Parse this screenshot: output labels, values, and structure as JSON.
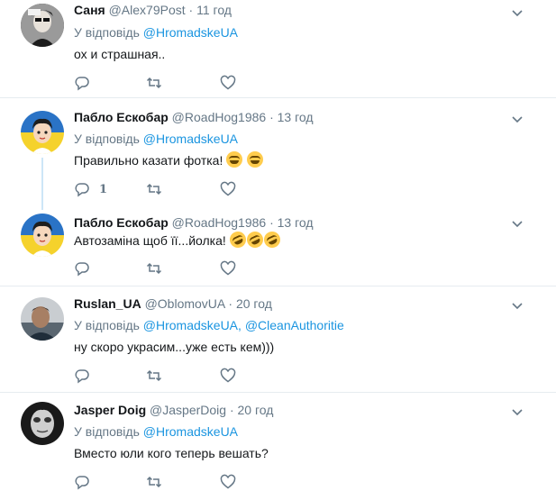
{
  "tweets": [
    {
      "name": "Саня",
      "handle": "@Alex79Post",
      "dot": "·",
      "time": "11 год",
      "reply_prefix": "У відповідь",
      "mentions": [
        "@HromadskeUA"
      ],
      "text": "ох и страшная..",
      "emojis": [],
      "reply_count": "",
      "avatar": "dark-portrait"
    },
    {
      "name": "Пабло Ескобар",
      "handle": "@RoadHog1986",
      "dot": "·",
      "time": "13 год",
      "reply_prefix": "У відповідь",
      "mentions": [
        "@HromadskeUA"
      ],
      "text": "Правильно казати фотка!",
      "emojis": [
        "face-with-tears-of-joy",
        "face-with-tears-of-joy"
      ],
      "reply_count": "1",
      "avatar": "cartoon-ua-flag"
    },
    {
      "name": "Пабло Ескобар",
      "handle": "@RoadHog1986",
      "dot": "·",
      "time": "13 год",
      "reply_prefix": "",
      "mentions": [],
      "text": "Автозаміна щоб її...йолка!",
      "emojis": [
        "rolling-on-the-floor-laughing",
        "rolling-on-the-floor-laughing",
        "rolling-on-the-floor-laughing"
      ],
      "reply_count": "",
      "avatar": "cartoon-ua-flag"
    },
    {
      "name": "Ruslan_UA",
      "handle": "@OblomovUA",
      "dot": "·",
      "time": "20 год",
      "reply_prefix": "У відповідь",
      "mentions": [
        "@HromadskeUA,",
        "@CleanAuthoritie"
      ],
      "text": "ну скоро украсим...уже есть кем)))",
      "emojis": [],
      "reply_count": "",
      "avatar": "man-photo"
    },
    {
      "name": "Jasper Doig",
      "handle": "@JasperDoig",
      "dot": "·",
      "time": "20 год",
      "reply_prefix": "У відповідь",
      "mentions": [
        "@HromadskeUA"
      ],
      "text": "Вместо юли кого теперь вешать?",
      "emojis": [],
      "reply_count": "",
      "avatar": "bw-face"
    }
  ],
  "icons": {
    "reply": "reply-icon",
    "retweet": "retweet-icon",
    "like": "heart-icon",
    "menu": "chevron-down-icon"
  },
  "colors": {
    "link": "#1b95e0",
    "muted": "#657786",
    "text": "#14171a",
    "divider": "#e6ecf0",
    "thread_line": "#cde6f7"
  }
}
